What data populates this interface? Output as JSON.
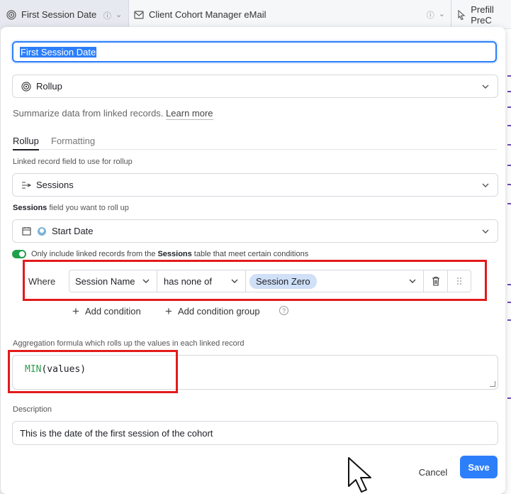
{
  "header": {
    "col1": {
      "label": "First Session Date"
    },
    "col2": {
      "label": "Client Cohort Manager eMail"
    },
    "col3": {
      "label": "Prefill PreC"
    }
  },
  "field": {
    "name_value": "First Session Date",
    "type_label": "Rollup",
    "help_text": "Summarize data from linked records.",
    "help_link": "Learn more"
  },
  "tabs": [
    {
      "label": "Rollup"
    },
    {
      "label": "Formatting"
    }
  ],
  "rollup": {
    "linked_label": "Linked record field to use for rollup",
    "linked_value": "Sessions",
    "field_label_bold": "Sessions",
    "field_label_rest": " field you want to roll up",
    "field_value": "Start Date",
    "toggle_pre": "Only include linked records from the",
    "toggle_bold": "Sessions",
    "toggle_post": "table that meet certain conditions",
    "toggle_on": true
  },
  "condition": {
    "where": "Where",
    "field": "Session Name",
    "operator": "has none of",
    "value_chip": "Session Zero"
  },
  "actions": {
    "add_condition": "Add condition",
    "add_condition_group": "Add condition group"
  },
  "aggregation": {
    "label": "Aggregation formula which rolls up the values in each linked record",
    "fn": "MIN",
    "args": "(values)"
  },
  "description": {
    "label": "Description",
    "value": "This is the date of the first session of the cohort"
  },
  "footer": {
    "cancel": "Cancel",
    "save": "Save"
  },
  "colors": {
    "accent": "#2d7ff9",
    "toggle": "#20a04b",
    "highlight": "#e21b1b",
    "chip": "#cfe0f7"
  }
}
